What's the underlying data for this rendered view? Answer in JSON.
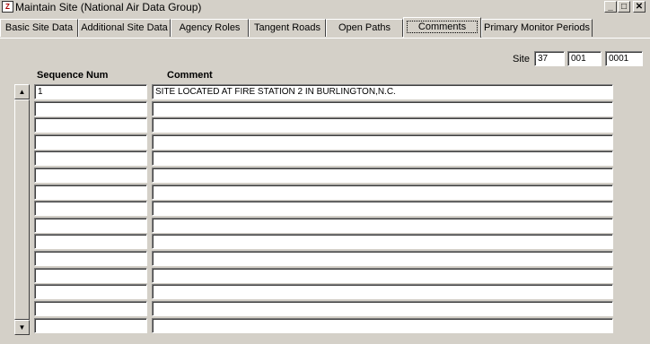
{
  "window": {
    "title": "Maintain Site (National Air Data Group)",
    "icon": "app-icon",
    "minimize_glyph": "_",
    "maximize_glyph": "□",
    "close_glyph": "✕"
  },
  "tabs": [
    {
      "label": "Basic Site Data",
      "active": false
    },
    {
      "label": "Additional Site Data",
      "active": false
    },
    {
      "label": "Agency Roles",
      "active": false
    },
    {
      "label": "Tangent Roads",
      "active": false
    },
    {
      "label": "Open Paths",
      "active": false
    },
    {
      "label": "Comments",
      "active": true
    },
    {
      "label": "Primary Monitor Periods",
      "active": false
    }
  ],
  "site": {
    "label": "Site",
    "state_code": "37",
    "county_code": "001",
    "site_number": "0001"
  },
  "grid": {
    "headers": {
      "sequence": "Sequence Num",
      "comment": "Comment"
    },
    "rows": [
      {
        "sequence": "1",
        "comment": "SITE LOCATED AT FIRE STATION 2 IN BURLINGTON,N.C."
      },
      {
        "sequence": "",
        "comment": ""
      },
      {
        "sequence": "",
        "comment": ""
      },
      {
        "sequence": "",
        "comment": ""
      },
      {
        "sequence": "",
        "comment": ""
      },
      {
        "sequence": "",
        "comment": ""
      },
      {
        "sequence": "",
        "comment": ""
      },
      {
        "sequence": "",
        "comment": ""
      },
      {
        "sequence": "",
        "comment": ""
      },
      {
        "sequence": "",
        "comment": ""
      },
      {
        "sequence": "",
        "comment": ""
      },
      {
        "sequence": "",
        "comment": ""
      },
      {
        "sequence": "",
        "comment": ""
      },
      {
        "sequence": "",
        "comment": ""
      },
      {
        "sequence": "",
        "comment": ""
      }
    ],
    "scroll_up_glyph": "▲",
    "scroll_down_glyph": "▼"
  }
}
